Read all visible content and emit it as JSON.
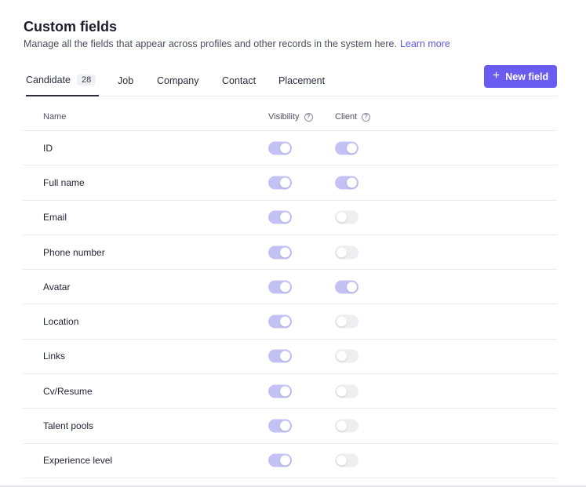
{
  "header": {
    "title": "Custom fields",
    "subtitle": "Manage all the fields that appear across profiles and other records in the system here.",
    "learn_more": "Learn more"
  },
  "tabs": [
    {
      "label": "Candidate",
      "count": "28",
      "active": true
    },
    {
      "label": "Job"
    },
    {
      "label": "Company"
    },
    {
      "label": "Contact"
    },
    {
      "label": "Placement"
    }
  ],
  "new_field_button": {
    "label": "New field",
    "icon": "plus-icon"
  },
  "table": {
    "columns": {
      "name": "Name",
      "visibility": "Visibility",
      "client": "Client"
    },
    "rows": [
      {
        "name": "ID",
        "visibility": true,
        "client": true
      },
      {
        "name": "Full name",
        "visibility": true,
        "client": true
      },
      {
        "name": "Email",
        "visibility": true,
        "client": false
      },
      {
        "name": "Phone number",
        "visibility": true,
        "client": false
      },
      {
        "name": "Avatar",
        "visibility": true,
        "client": true
      },
      {
        "name": "Location",
        "visibility": true,
        "client": false
      },
      {
        "name": "Links",
        "visibility": true,
        "client": false
      },
      {
        "name": "Cv/Resume",
        "visibility": true,
        "client": false
      },
      {
        "name": "Talent pools",
        "visibility": true,
        "client": false
      },
      {
        "name": "Experience level",
        "visibility": true,
        "client": false
      }
    ]
  },
  "colors": {
    "accent": "#6a5cf0",
    "toggle_on": "#c4c1f5",
    "toggle_off": "#eeeef2",
    "link": "#5b57e6"
  }
}
